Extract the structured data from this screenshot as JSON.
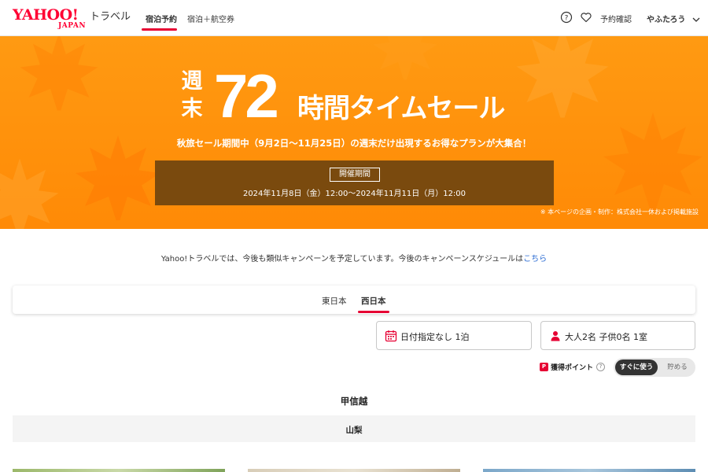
{
  "header": {
    "logo_main": "YAHOO!",
    "logo_sub": "JAPAN",
    "logo_service": "トラベル",
    "tabs": [
      {
        "label": "宿泊予約",
        "active": true
      },
      {
        "label": "宿泊＋航空券",
        "active": false
      }
    ],
    "help_icon": "question-circle-icon",
    "favorite_icon": "heart-icon",
    "reservations_label": "予約確認",
    "user_name": "やふたろう",
    "user_menu_icon": "chevron-down-icon"
  },
  "hero": {
    "title_prefix": "週末",
    "title_number": "72",
    "title_rest": "時間タイムセール",
    "subtitle": "秋旅セール期間中（9月2日〜11月25日）の週末だけ出現するお得なプランが大集合！",
    "period_label": "開催期間",
    "period_dates": "2024年11月8日（金）12:00〜2024年11月11日（月）12:00",
    "note": "※ 本ページの企画・制作：株式会社一休および掲載施設",
    "background_color": "#ff9010",
    "period_box_color": "#7a4a0e"
  },
  "campaign": {
    "text": "Yahoo!トラベルでは、今後も類似キャンペーンを予定しています。今後のキャンペーンスケジュールは",
    "link": "こちら"
  },
  "region_tabs": [
    {
      "label": "東日本",
      "active": false
    },
    {
      "label": "西日本",
      "active": true
    }
  ],
  "search": {
    "date_value": "日付指定なし 1泊",
    "date_icon": "calendar-icon",
    "guests_value": "大人2名 子供0名 1室",
    "guests_icon": "person-icon"
  },
  "points": {
    "label": "獲得ポイント",
    "icon_text": "P",
    "help_text": "?",
    "toggle_on": "すぐに使う",
    "toggle_off": "貯める"
  },
  "area": {
    "title": "甲信越",
    "prefecture": "山梨"
  },
  "colors": {
    "accent": "#e60033",
    "link": "#2a6bd3"
  }
}
